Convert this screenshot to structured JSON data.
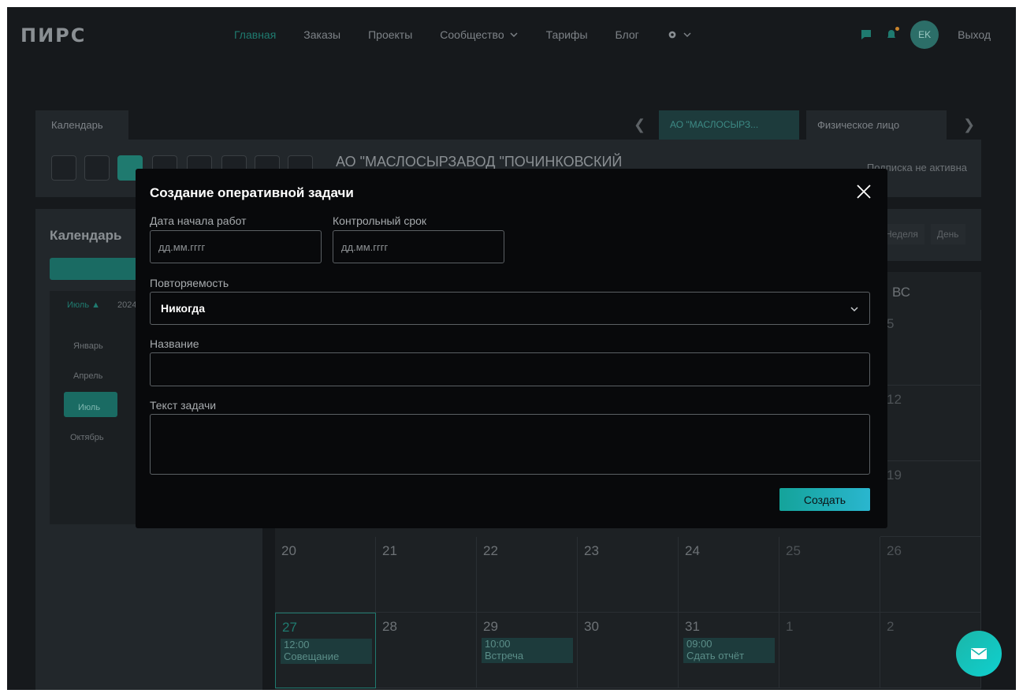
{
  "header": {
    "logo": "ПИРС",
    "nav": [
      {
        "label": "Главная",
        "active": true
      },
      {
        "label": "Заказы"
      },
      {
        "label": "Проекты"
      },
      {
        "label": "Сообщество",
        "dropdown": true
      },
      {
        "label": "Тарифы"
      },
      {
        "label": "Блог"
      }
    ],
    "avatar_initials": "EK",
    "logout_label": "Выход"
  },
  "tabs": {
    "calendar": "Календарь",
    "company": "АО \"МАСЛОСЫРЗ...",
    "person": "Физическое лицо"
  },
  "toolbar": {
    "company_title": "АО \"МАСЛОСЫРЗАВОД \"ПОЧИНКОВСКИЙ",
    "subscription_status": "Подписка не активна"
  },
  "left_panel": {
    "title": "Календарь",
    "month_picker": "Июль",
    "year": "2024",
    "months": [
      "Январь",
      "Апрель",
      "Июль",
      "Октябрь"
    ]
  },
  "calendar": {
    "view_buttons": [
      "Неделя",
      "День"
    ],
    "sunday_header": "ВС",
    "visible_days": [
      {
        "day": "5"
      },
      {
        "day": "12"
      },
      {
        "day": "19"
      }
    ],
    "week4": [
      "20",
      "21",
      "22",
      "23",
      "24",
      "25",
      "26"
    ],
    "week5": [
      "27",
      "28",
      "29",
      "30",
      "31",
      "1",
      "2"
    ],
    "events": [
      {
        "day": "27",
        "time": "12:00",
        "title": "Совещание"
      },
      {
        "day": "29",
        "time": "10:00",
        "title": "Встреча"
      },
      {
        "day": "31",
        "time": "09:00",
        "title": "Сдать отчёт"
      }
    ]
  },
  "modal": {
    "title": "Создание оперативной задачи",
    "start_date": {
      "label": "Дата начала работ",
      "placeholder": "дд.мм.гггг"
    },
    "deadline": {
      "label": "Контрольный срок",
      "placeholder": "дд.мм.гггг"
    },
    "repeat": {
      "label": "Повторяемость",
      "value": "Никогда"
    },
    "name": {
      "label": "Название",
      "value": ""
    },
    "text": {
      "label": "Текст задачи",
      "value": ""
    },
    "submit_label": "Создать"
  },
  "colors": {
    "accent": "#1f7a6f",
    "modal_bg": "#08090b",
    "button_gradient_start": "#14a39a",
    "button_gradient_end": "#2ab6cf"
  }
}
